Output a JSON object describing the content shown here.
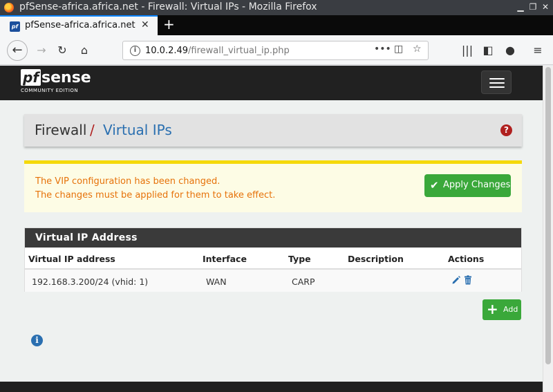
{
  "window": {
    "title": "pfSense-africa.africa.net - Firewall: Virtual IPs - Mozilla Firefox"
  },
  "browser": {
    "tab_title": "pfSense-africa.africa.net",
    "favicon_text": "pf",
    "url_host": "10.0.2.49",
    "url_path": "/firewall_virtual_ip.php"
  },
  "header": {
    "logo_pf": "pf",
    "logo_sense": "sense",
    "logo_edition": "COMMUNITY EDITION"
  },
  "breadcrumb": {
    "first": "Firewall",
    "separator": "/",
    "second": "Virtual IPs"
  },
  "alert": {
    "line1": "The VIP configuration has been changed.",
    "line2": "The changes must be applied for them to take effect.",
    "apply_label": "Apply Changes"
  },
  "panel": {
    "title": "Virtual IP Address",
    "columns": [
      "Virtual IP address",
      "Interface",
      "Type",
      "Description",
      "Actions"
    ],
    "rows": [
      {
        "address": "192.168.3.200/24 (vhid: 1)",
        "interface": "WAN",
        "type": "CARP",
        "description": ""
      }
    ]
  },
  "buttons": {
    "add_label": "Add"
  },
  "colors": {
    "brand_dark": "#212121",
    "accent_red": "#b0201f",
    "link_blue": "#2a6fb0",
    "success_green": "#3aa83a",
    "warning_yellow": "#f5d90b",
    "warning_text": "#e6720a"
  }
}
